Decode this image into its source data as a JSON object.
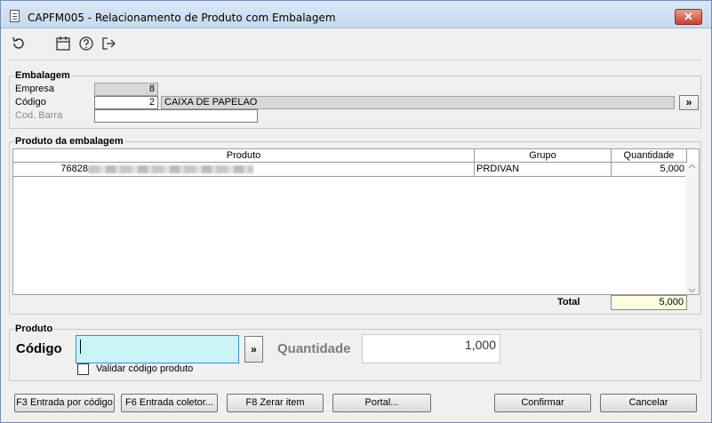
{
  "window": {
    "title": "CAPFM005 - Relacionamento de Produto com Embalagem",
    "close_label": "✕"
  },
  "toolbar": {
    "icons": [
      "refresh-icon",
      "calendar-icon",
      "help-icon",
      "exit-icon"
    ]
  },
  "embalagem": {
    "title": "Embalagem",
    "empresa_label": "Empresa",
    "empresa_value": "8",
    "codigo_label": "Código",
    "codigo_value": "2",
    "descricao_value": "CAIXA DE PAPELAO",
    "lookup_label": "»",
    "cod_barra_label": "Cod. Barra",
    "cod_barra_value": ""
  },
  "produto_embalagem": {
    "title": "Produto da embalagem",
    "columns": [
      "Produto",
      "Grupo",
      "Quantidade"
    ],
    "rows": [
      {
        "codigo": "76828",
        "grupo": "PRDIVAN",
        "quantidade": "5,000"
      }
    ],
    "total_label": "Total",
    "total_value": "5,000"
  },
  "produto": {
    "title": "Produto",
    "codigo_label": "Código",
    "codigo_value": "",
    "lookup_label": "»",
    "quantidade_label": "Quantidade",
    "quantidade_value": "1,000",
    "validar_label": "Validar código produto",
    "validar_checked": false
  },
  "buttons": {
    "f3": "F3 Entrada por código",
    "f6": "F6 Entrada coletor...",
    "f8": "F8 Zerar item",
    "portal": "Portal...",
    "confirmar": "Confirmar",
    "cancelar": "Cancelar"
  }
}
